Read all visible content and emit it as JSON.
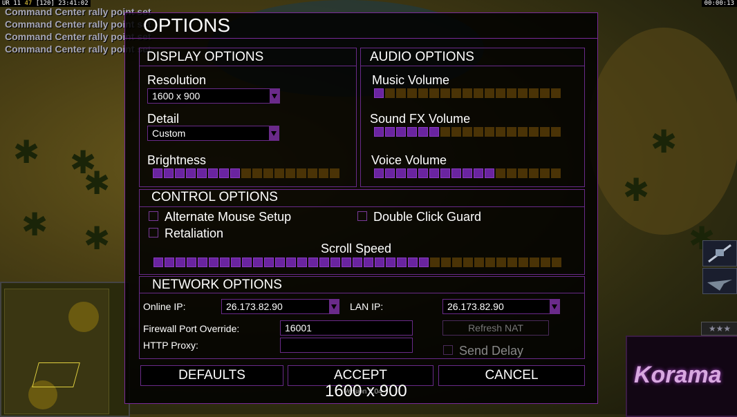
{
  "hud": {
    "status_prefix": "UR 11",
    "status_money": "47",
    "status_units": "[120]",
    "status_time": "23:41:02",
    "game_clock": "00:00:13",
    "messages": [
      "Command Center rally point set",
      "Command Center rally point set",
      "Command Center rally point set",
      "Command Center rally point set"
    ],
    "logo": "Korama"
  },
  "dialog": {
    "title": "OPTIONS",
    "display": {
      "title": "DISPLAY OPTIONS",
      "resolution_label": "Resolution",
      "resolution_value": "1600 x 900",
      "detail_label": "Detail",
      "detail_value": "Custom",
      "brightness_label": "Brightness",
      "brightness_level": {
        "on": 8,
        "total": 17
      }
    },
    "audio": {
      "title": "AUDIO OPTIONS",
      "music_label": "Music Volume",
      "music_level": {
        "on": 1,
        "total": 17
      },
      "sfx_label": "Sound FX Volume",
      "sfx_level": {
        "on": 6,
        "total": 17
      },
      "voice_label": "Voice Volume",
      "voice_level": {
        "on": 11,
        "total": 17
      }
    },
    "control": {
      "title": "CONTROL OPTIONS",
      "alt_mouse_label": "Alternate Mouse Setup",
      "alt_mouse_checked": false,
      "double_click_label": "Double Click Guard",
      "double_click_checked": false,
      "retaliation_label": "Retaliation",
      "retaliation_checked": false,
      "scroll_label": "Scroll Speed",
      "scroll_level": {
        "on": 25,
        "total": 37
      }
    },
    "network": {
      "title": "NETWORK OPTIONS",
      "online_ip_label": "Online IP:",
      "online_ip_value": "26.173.82.90",
      "lan_ip_label": "LAN IP:",
      "lan_ip_value": "26.173.82.90",
      "firewall_label": "Firewall Port Override:",
      "firewall_value": "16001",
      "http_proxy_label": "HTTP Proxy:",
      "http_proxy_value": "",
      "refresh_nat_label": "Refresh NAT",
      "send_delay_label": "Send Delay",
      "send_delay_checked": false
    },
    "buttons": {
      "defaults": "DEFAULTS",
      "accept": "ACCEPT",
      "cancel": "CANCEL"
    },
    "overlay_resolution": "1600 x 900",
    "version": "Version 1.04"
  },
  "colors": {
    "accent": "#6a2a8a",
    "bar_on": "#6a24a0",
    "bar_off": "#4a3306"
  }
}
